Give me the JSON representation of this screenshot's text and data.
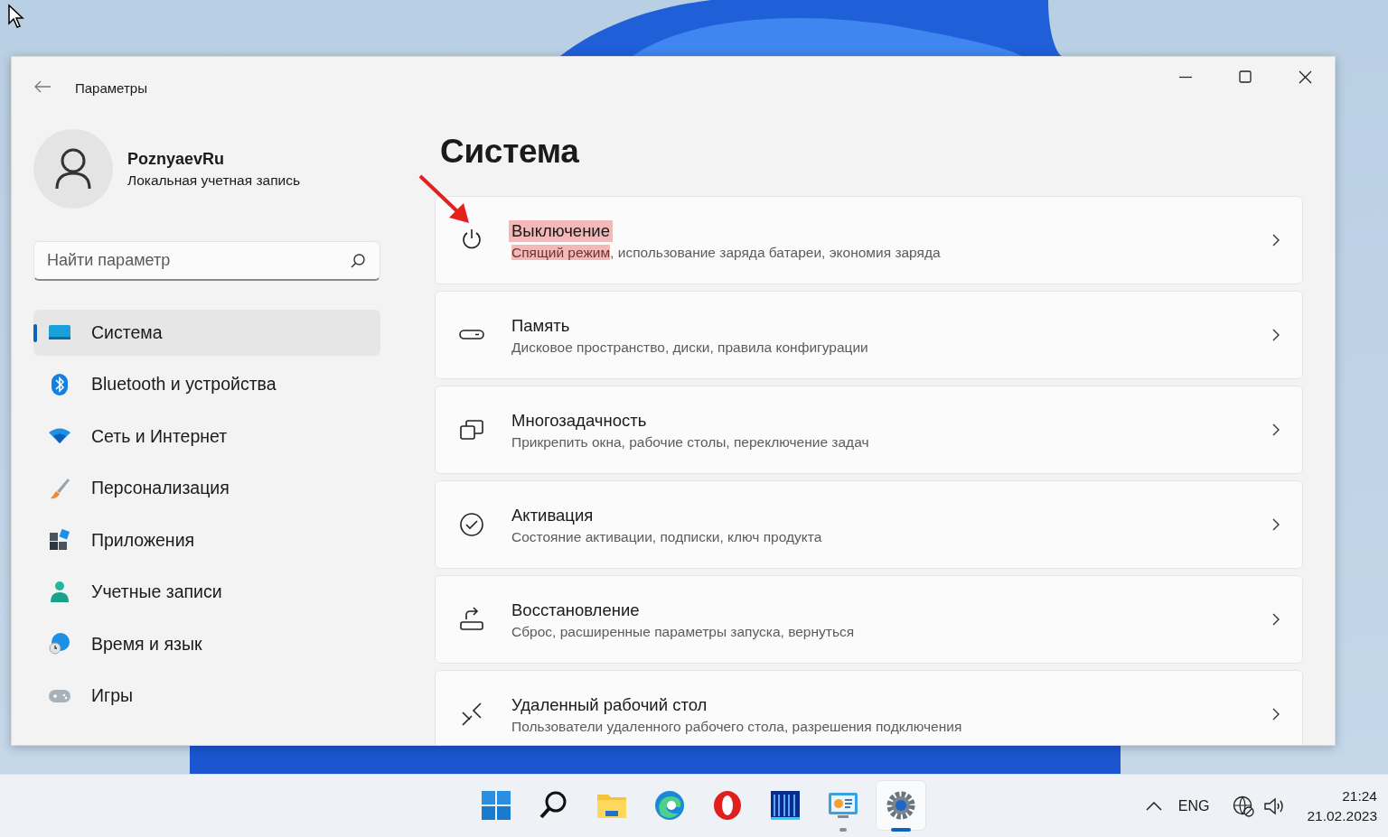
{
  "window": {
    "title": "Параметры"
  },
  "account": {
    "name": "PoznyaevRu",
    "type": "Локальная учетная запись"
  },
  "search": {
    "placeholder": "Найти параметр"
  },
  "sidebar": {
    "items": [
      {
        "label": "Система",
        "selected": true
      },
      {
        "label": "Bluetooth и устройства",
        "selected": false
      },
      {
        "label": "Сеть и Интернет",
        "selected": false
      },
      {
        "label": "Персонализация",
        "selected": false
      },
      {
        "label": "Приложения",
        "selected": false
      },
      {
        "label": "Учетные записи",
        "selected": false
      },
      {
        "label": "Время и язык",
        "selected": false
      },
      {
        "label": "Игры",
        "selected": false
      }
    ]
  },
  "page": {
    "heading": "Система"
  },
  "cards": [
    {
      "title": "Выключение",
      "title_highlighted": true,
      "subtitle": [
        {
          "text": "Спящий режим",
          "highlighted": true
        },
        {
          "text": ", использование заряда батареи, экономия заряда",
          "highlighted": false
        }
      ]
    },
    {
      "title": "Память",
      "title_highlighted": false,
      "subtitle": [
        {
          "text": "Дисковое пространство, диски, правила конфигурации",
          "highlighted": false
        }
      ]
    },
    {
      "title": "Многозадачность",
      "title_highlighted": false,
      "subtitle": [
        {
          "text": "Прикрепить окна, рабочие столы, переключение задач",
          "highlighted": false
        }
      ]
    },
    {
      "title": "Активация",
      "title_highlighted": false,
      "subtitle": [
        {
          "text": "Состояние активации, подписки, ключ продукта",
          "highlighted": false
        }
      ]
    },
    {
      "title": "Восстановление",
      "title_highlighted": false,
      "subtitle": [
        {
          "text": "Сброс, расширенные параметры запуска, вернуться",
          "highlighted": false
        }
      ]
    },
    {
      "title": "Удаленный рабочий стол",
      "title_highlighted": false,
      "subtitle": [
        {
          "text": "Пользователи удаленного рабочего стола, разрешения подключения",
          "highlighted": false
        }
      ]
    }
  ],
  "taskbar": {
    "apps": [
      {
        "selected": false,
        "running": false
      },
      {
        "selected": false,
        "running": false
      },
      {
        "selected": false,
        "running": false
      },
      {
        "selected": false,
        "running": false
      },
      {
        "selected": false,
        "running": false
      },
      {
        "selected": false,
        "running": false
      },
      {
        "selected": false,
        "running": true
      },
      {
        "selected": true,
        "running": true
      }
    ],
    "language": "ENG",
    "time": "21:24",
    "date": "21.02.2023"
  }
}
